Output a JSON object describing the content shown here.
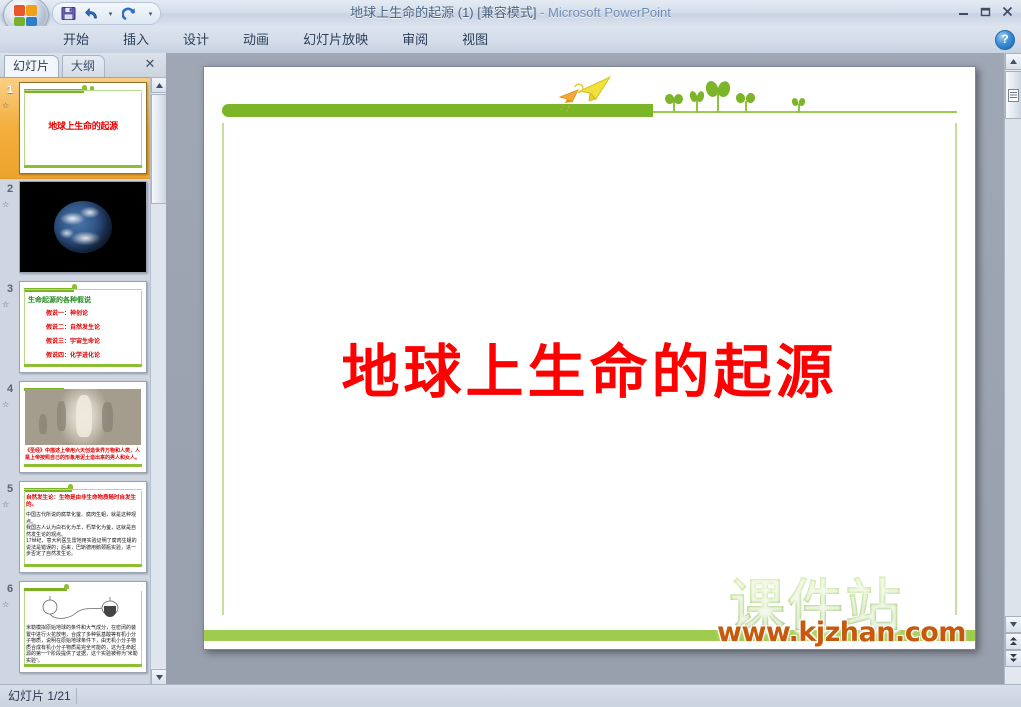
{
  "window": {
    "title_main": "地球上生命的起源 (1) [兼容模式]",
    "title_sep": " - ",
    "title_app": "Microsoft PowerPoint",
    "minimize": "–",
    "restore": "❐",
    "close": "✕",
    "help": "?"
  },
  "quick_access": {
    "save": "save-icon",
    "undo": "undo-icon",
    "undo_dropdown": "▾",
    "redo": "redo-icon",
    "customize": "▾"
  },
  "ribbon": {
    "tabs": [
      {
        "label": "开始"
      },
      {
        "label": "插入"
      },
      {
        "label": "设计"
      },
      {
        "label": "动画"
      },
      {
        "label": "幻灯片放映"
      },
      {
        "label": "审阅"
      },
      {
        "label": "视图"
      }
    ]
  },
  "left_pane": {
    "tab_slides": "幻灯片",
    "tab_outline": "大纲",
    "close": "✕",
    "scroll_up": "▲",
    "scroll_down": "▼",
    "slides": [
      {
        "number": "1",
        "kind": "title",
        "title_text": "地球上生命的起源",
        "selected": true
      },
      {
        "number": "2",
        "kind": "earth-photo",
        "selected": false
      },
      {
        "number": "3",
        "kind": "list",
        "heading": "生命起源的各种假说",
        "lines": [
          "假说一：神创论",
          "假说二：自然发生论",
          "假说三：宇宙生命论",
          "假说四：化学进化论"
        ],
        "selected": false
      },
      {
        "number": "4",
        "kind": "engraving",
        "caption": "《圣经》中描述上帝用六天创造世界万物和人类，人是上帝按照自己的形象用泥土造出来的男人和女人。",
        "selected": false
      },
      {
        "number": "5",
        "kind": "text",
        "heading": "自然发生论：生物是由非生命物质随时自发生的。",
        "paragraphs": [
          "中国古代所说的腐草化萤、腐肉生蛆，就是这种观点。",
          "我国古人认为白石化为羊，朽草化为萤，这就是自然发生论的观点。",
          "17世纪，意大利医生雷地用实验证明了腐肉生蛆的说法是错误的；后来，巴斯德用鹅颈瓶实验，进一步否定了自然发生论。"
        ],
        "selected": false
      },
      {
        "number": "6",
        "kind": "diagram",
        "body": "米勒模拟原始地球的条件和大气成分，在密闭的装置中进行火花放电，合成了多种氨基酸等有机小分子物质，说明在原始地球条件下，由无机小分子物质合成有机小分子物质是完全可能的，这为生命起源的第一个阶段提供了证据，这个实验被称为“米勒实验”。",
        "selected": false
      }
    ]
  },
  "slide_view": {
    "title": "地球上生命的起源",
    "watermark_cn": "课件站",
    "watermark_url": "www.kjzhan.com",
    "scroll_up": "▲",
    "scroll_down": "▼",
    "prev_slide": "▲",
    "next_slide": "▼"
  },
  "status_bar": {
    "slide_counter": "幻灯片 1/21"
  },
  "colors": {
    "title_red": "#ff0000",
    "theme_green": "#7cb528",
    "light_green": "#9fcc4f",
    "selection_orange": "#f3ae3c",
    "watermark_green": "#8cc63f",
    "watermark_orange": "#c7590e"
  }
}
